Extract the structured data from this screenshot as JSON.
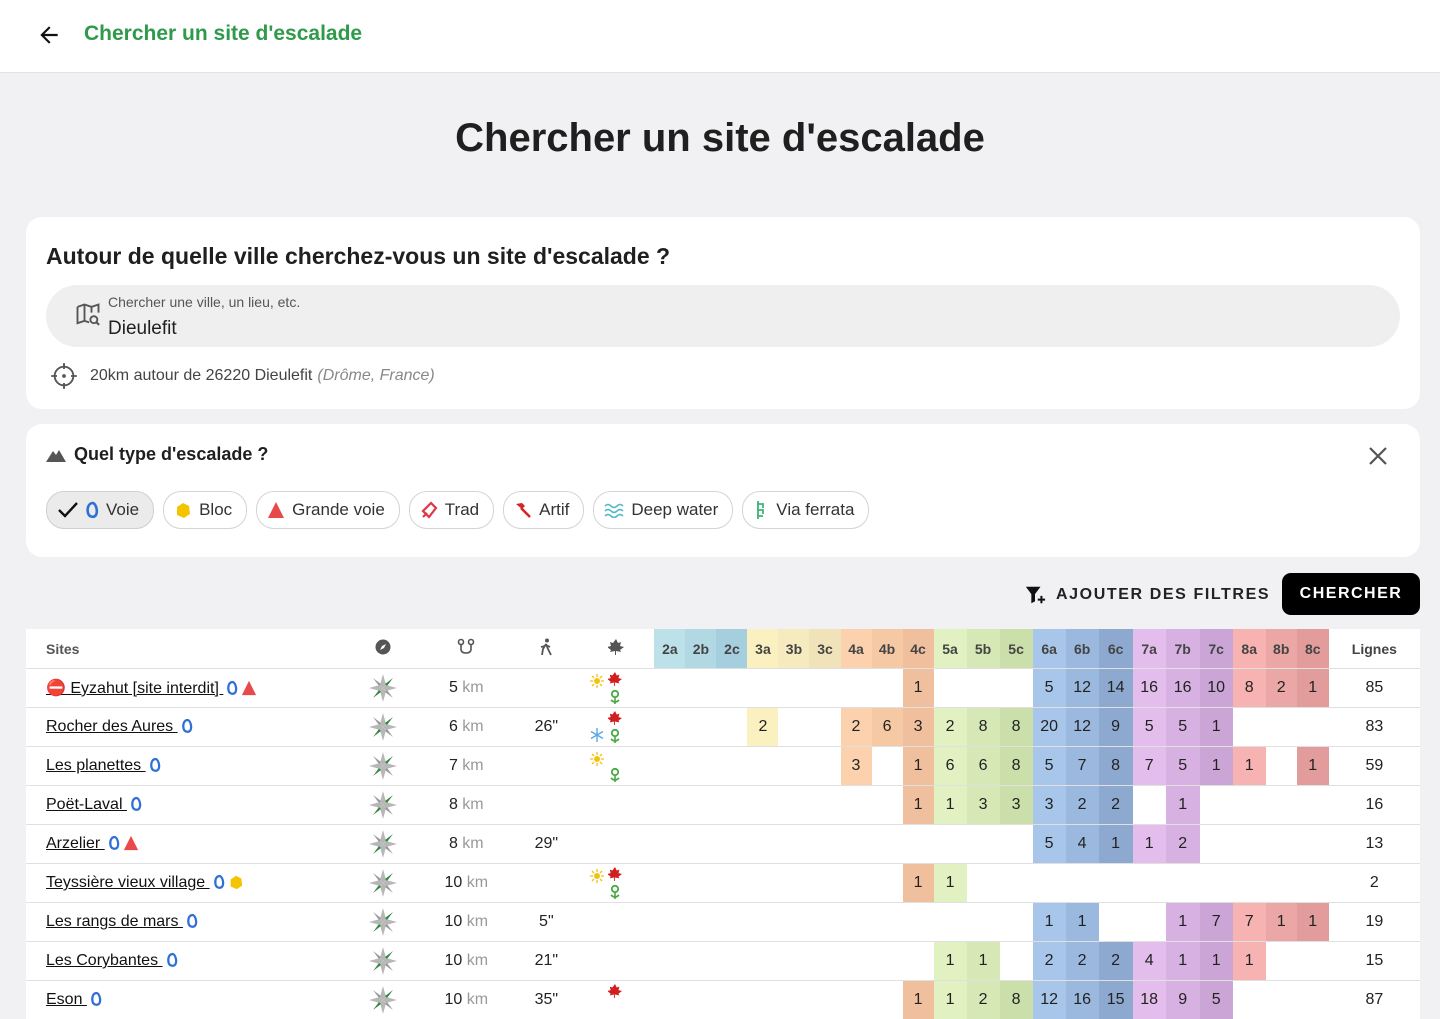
{
  "header": {
    "title": "Chercher un site d'escalade"
  },
  "page": {
    "title": "Chercher un site d'escalade"
  },
  "location": {
    "question": "Autour de quelle ville cherchez-vous un site d'escalade ?",
    "placeholder": "Chercher une ville, un lieu, etc.",
    "value": "Dieulefit",
    "radius_text": "20km autour de 26220 Dieulefit",
    "region": "(Drôme, France)"
  },
  "types": {
    "title": "Quel type d'escalade ?",
    "chips": [
      {
        "label": "Voie",
        "selected": true
      },
      {
        "label": "Bloc",
        "selected": false
      },
      {
        "label": "Grande voie",
        "selected": false
      },
      {
        "label": "Trad",
        "selected": false
      },
      {
        "label": "Artif",
        "selected": false
      },
      {
        "label": "Deep water",
        "selected": false
      },
      {
        "label": "Via ferrata",
        "selected": false
      }
    ]
  },
  "actions": {
    "filters": "AJOUTER DES FILTRES",
    "search": "CHERCHER"
  },
  "table": {
    "sites_header": "Sites",
    "lines_header": "Lignes",
    "km_unit": "km",
    "grades": [
      "2a",
      "2b",
      "2c",
      "3a",
      "3b",
      "3c",
      "4a",
      "4b",
      "4c",
      "5a",
      "5b",
      "5c",
      "6a",
      "6b",
      "6c",
      "7a",
      "7b",
      "7c",
      "8a",
      "8b",
      "8c"
    ],
    "grade_colors": [
      "#bde1e9",
      "#b2d8e4",
      "#a5cfdf",
      "#fbf1c0",
      "#f6eabf",
      "#f1e3b9",
      "#fbd2ad",
      "#f6c9a5",
      "#f0c09e",
      "#e1f1c1",
      "#d6e8b6",
      "#cbdfaa",
      "#a7c6ea",
      "#9bb8de",
      "#8ea9cf",
      "#e3bdec",
      "#d7b1e2",
      "#cba5d6",
      "#f7b2b2",
      "#eba6a6",
      "#e29c9c"
    ],
    "rows": [
      {
        "name": "⛔ Eyzahut [site interdit]",
        "types": [
          "voie",
          "grande-voie"
        ],
        "dist": "5",
        "approach": "",
        "seasons": [
          "sun",
          "leaf",
          "flower"
        ],
        "grades": [
          "",
          "",
          "",
          "",
          "",
          "",
          "",
          "",
          "1",
          "",
          "",
          "",
          "5",
          "12",
          "14",
          "16",
          "16",
          "10",
          "8",
          "2",
          "1"
        ],
        "lines": "85"
      },
      {
        "name": "Rocher des Aures",
        "types": [
          "voie"
        ],
        "dist": "6",
        "approach": "26\"",
        "seasons": [
          "leaf",
          "snow",
          "flower"
        ],
        "grades": [
          "",
          "",
          "",
          "2",
          "",
          "",
          "2",
          "6",
          "3",
          "2",
          "8",
          "8",
          "20",
          "12",
          "9",
          "5",
          "5",
          "1",
          "",
          "",
          ""
        ],
        "lines": "83"
      },
      {
        "name": "Les planettes",
        "types": [
          "voie"
        ],
        "dist": "7",
        "approach": "",
        "seasons": [
          "sun",
          "flower"
        ],
        "grades": [
          "",
          "",
          "",
          "",
          "",
          "",
          "3",
          "",
          "1",
          "6",
          "6",
          "8",
          "5",
          "7",
          "8",
          "7",
          "5",
          "1",
          "1",
          "",
          "1"
        ],
        "lines": "59"
      },
      {
        "name": "Poët-Laval",
        "types": [
          "voie"
        ],
        "dist": "8",
        "approach": "",
        "seasons": [],
        "grades": [
          "",
          "",
          "",
          "",
          "",
          "",
          "",
          "",
          "1",
          "1",
          "3",
          "3",
          "3",
          "2",
          "2",
          "",
          "1",
          "",
          "",
          "",
          ""
        ],
        "lines": "16"
      },
      {
        "name": "Arzelier",
        "types": [
          "voie",
          "grande-voie"
        ],
        "dist": "8",
        "approach": "29\"",
        "seasons": [],
        "grades": [
          "",
          "",
          "",
          "",
          "",
          "",
          "",
          "",
          "",
          "",
          "",
          "",
          "5",
          "4",
          "1",
          "1",
          "2",
          "",
          "",
          "",
          ""
        ],
        "lines": "13"
      },
      {
        "name": "Teyssière vieux village",
        "types": [
          "voie",
          "bloc"
        ],
        "dist": "10",
        "approach": "",
        "seasons": [
          "sun",
          "leaf",
          "flower"
        ],
        "grades": [
          "",
          "",
          "",
          "",
          "",
          "",
          "",
          "",
          "1",
          "1",
          "",
          "",
          "",
          "",
          "",
          "",
          "",
          "",
          "",
          "",
          ""
        ],
        "lines": "2"
      },
      {
        "name": "Les rangs de mars",
        "types": [
          "voie"
        ],
        "dist": "10",
        "approach": "5\"",
        "seasons": [],
        "grades": [
          "",
          "",
          "",
          "",
          "",
          "",
          "",
          "",
          "",
          "",
          "",
          "",
          "1",
          "1",
          "",
          "",
          "1",
          "7",
          "7",
          "1",
          "1"
        ],
        "lines": "19"
      },
      {
        "name": "Les Corybantes",
        "types": [
          "voie"
        ],
        "dist": "10",
        "approach": "21\"",
        "seasons": [],
        "grades": [
          "",
          "",
          "",
          "",
          "",
          "",
          "",
          "",
          "",
          "1",
          "1",
          "",
          "2",
          "2",
          "2",
          "4",
          "1",
          "1",
          "1",
          "",
          ""
        ],
        "lines": "15"
      },
      {
        "name": "Eson",
        "types": [
          "voie"
        ],
        "dist": "10",
        "approach": "35\"",
        "seasons": [
          "leaf"
        ],
        "grades": [
          "",
          "",
          "",
          "",
          "",
          "",
          "",
          "",
          "1",
          "1",
          "2",
          "8",
          "12",
          "16",
          "15",
          "18",
          "9",
          "5",
          "",
          "",
          ""
        ],
        "lines": "87"
      }
    ]
  }
}
